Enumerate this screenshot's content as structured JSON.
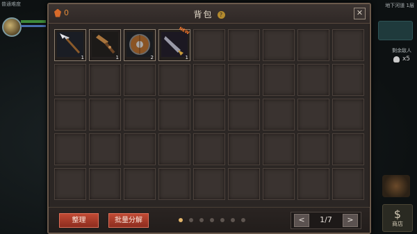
{
  "hud": {
    "difficulty": "普通难度",
    "floor": "地下河道 1层",
    "enemies_label": "剩余敌人",
    "enemies_count": "x5",
    "shop_glyph": "$",
    "shop_label": "商店"
  },
  "panel": {
    "title": "背包",
    "help": "?",
    "close": "✕",
    "currency": "0"
  },
  "items": [
    {
      "name": "spear",
      "count": "1"
    },
    {
      "name": "wooden-club",
      "count": "1"
    },
    {
      "name": "round-shield",
      "count": "2"
    },
    {
      "name": "blade",
      "count": "1",
      "new": "NEW"
    }
  ],
  "grid": {
    "columns": 9,
    "rows": 5
  },
  "footer": {
    "sort_label": "整理",
    "batch_label": "批量分解",
    "page_indicator": "1/7",
    "prev": "<",
    "next": ">",
    "dots": 7,
    "active_dot": 0
  },
  "colors": {
    "accent_orange": "#e08a3a",
    "button_red": "#c04a34",
    "dot_active": "#e3b56a"
  }
}
